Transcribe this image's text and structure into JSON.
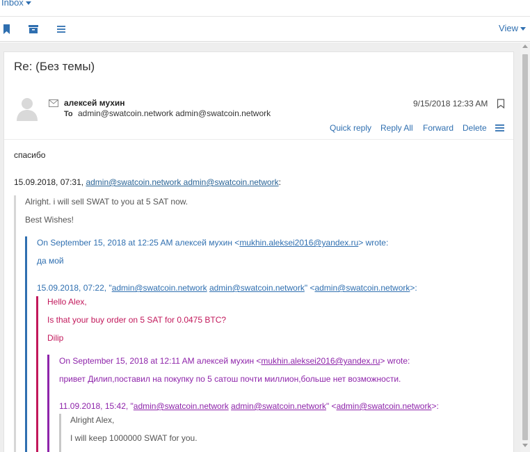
{
  "nav": {
    "folder_label": "Inbox",
    "view_label": "View"
  },
  "toolbar": {
    "icons": [
      "bookmark-icon",
      "archive-icon",
      "list-icon"
    ]
  },
  "message": {
    "subject": "Re: (Без темы)",
    "from_name": "алексей мухин",
    "to_label": "To",
    "to_value": "admin@swatcoin.network admin@swatcoin.network",
    "date": "9/15/2018 12:33 AM",
    "actions": {
      "quick_reply": "Quick reply",
      "reply_all": "Reply All",
      "forward": "Forward",
      "delete": "Delete"
    }
  },
  "body": {
    "line1": "спасибо",
    "q1_header_prefix": "15.09.2018, 07:31, ",
    "q1_header_link": "admin@swatcoin.network admin@swatcoin.network",
    "q1_header_suffix": ":",
    "q1_line1": "Alright. i will sell SWAT to you at 5 SAT now.",
    "q1_line2": "Best Wishes!",
    "q2_header_prefix": "On September 15, 2018 at 12:25 AM алексей мухин <",
    "q2_header_link": "mukhin.aleksei2016@yandex.ru",
    "q2_header_suffix": "> wrote:",
    "q2_line1": "да мой",
    "q3_header_prefix": "15.09.2018, 07:22, \"",
    "q3_link1": "admin@swatcoin.network",
    "q3_link2": "admin@swatcoin.network",
    "q3_mid": "\" <",
    "q3_link3": "admin@swatcoin.network",
    "q3_suffix": ">:",
    "q3_line1": "Hello Alex,",
    "q3_line2": "Is that your buy order on 5 SAT for 0.0475 BTC?",
    "q3_line3": "Dilip",
    "q4_header_prefix": "On September 15, 2018 at 12:11 AM алексей мухин <",
    "q4_header_link": "mukhin.aleksei2016@yandex.ru",
    "q4_header_suffix": "> wrote:",
    "q4_line1": "привет Дилип,поставил на покупку по 5 сатош почти миллион,больше нет возможности.",
    "q5_header_prefix": "11.09.2018, 15:42, \"",
    "q5_link1": "admin@swatcoin.network",
    "q5_link2": "admin@swatcoin.network",
    "q5_mid": "\" <",
    "q5_link3": "admin@swatcoin.network",
    "q5_suffix": ">:",
    "q5_line1": "Alright Alex,",
    "q5_line2": "I will keep 1000000 SWAT for you."
  },
  "colors": {
    "accent": "#2f6fb0",
    "quote1": "#d0d0d0",
    "quote2": "#2f6fb0",
    "quote3": "#c2185b",
    "quote4": "#8e24aa",
    "quote5": "#c0c0c0"
  }
}
